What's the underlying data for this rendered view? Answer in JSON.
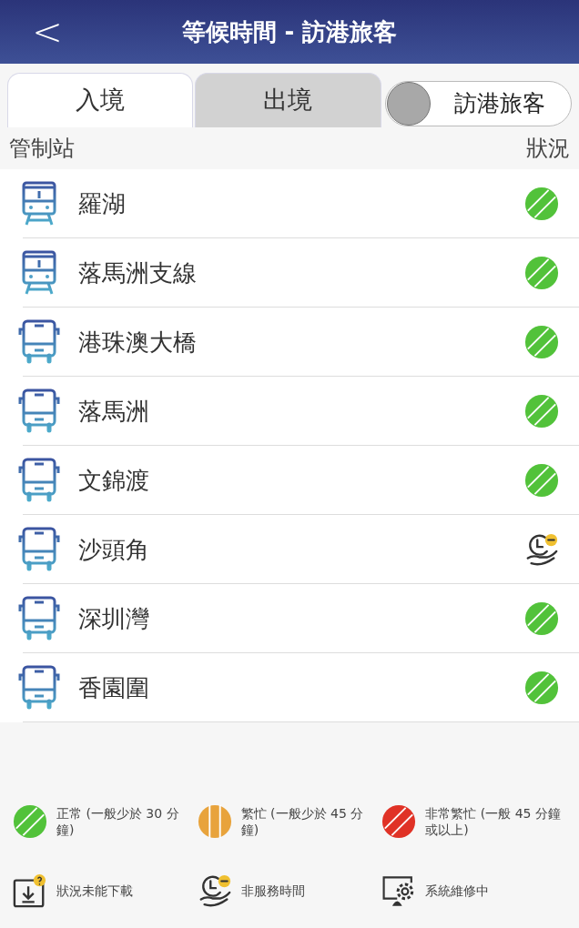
{
  "header": {
    "back": "<",
    "title": "等候時間 - 訪港旅客"
  },
  "tabs": [
    {
      "label": "入境",
      "selected": true
    },
    {
      "label": "出境",
      "selected": false
    }
  ],
  "toggle": {
    "label": "訪港旅客",
    "on": false
  },
  "columns": {
    "station": "管制站",
    "status": "狀況"
  },
  "stations": [
    {
      "name": "羅湖",
      "vehicle": {
        "kind": "train"
      },
      "status": {
        "kind": "normal"
      }
    },
    {
      "name": "落馬洲支線",
      "vehicle": {
        "kind": "train"
      },
      "status": {
        "kind": "normal"
      }
    },
    {
      "name": "港珠澳大橋",
      "vehicle": {
        "kind": "bus"
      },
      "status": {
        "kind": "normal"
      }
    },
    {
      "name": "落馬洲",
      "vehicle": {
        "kind": "bus"
      },
      "status": {
        "kind": "normal"
      }
    },
    {
      "name": "文錦渡",
      "vehicle": {
        "kind": "bus"
      },
      "status": {
        "kind": "normal"
      }
    },
    {
      "name": "沙頭角",
      "vehicle": {
        "kind": "bus"
      },
      "status": {
        "kind": "non_service"
      }
    },
    {
      "name": "深圳灣",
      "vehicle": {
        "kind": "bus"
      },
      "status": {
        "kind": "normal"
      }
    },
    {
      "name": "香園圍",
      "vehicle": {
        "kind": "bus"
      },
      "status": {
        "kind": "normal"
      }
    }
  ],
  "legend": [
    {
      "kind": "normal",
      "label": "正常 (一般少於 30 分鐘)"
    },
    {
      "kind": "busy",
      "label": "繁忙 (一般少於 45 分鐘)"
    },
    {
      "kind": "very_busy",
      "label": "非常繁忙 (一般 45 分鐘或以上)"
    },
    {
      "kind": "no_download",
      "label": "狀況未能下載"
    },
    {
      "kind": "non_service",
      "label": "非服務時間"
    },
    {
      "kind": "maintenance",
      "label": "系統維修中"
    }
  ]
}
